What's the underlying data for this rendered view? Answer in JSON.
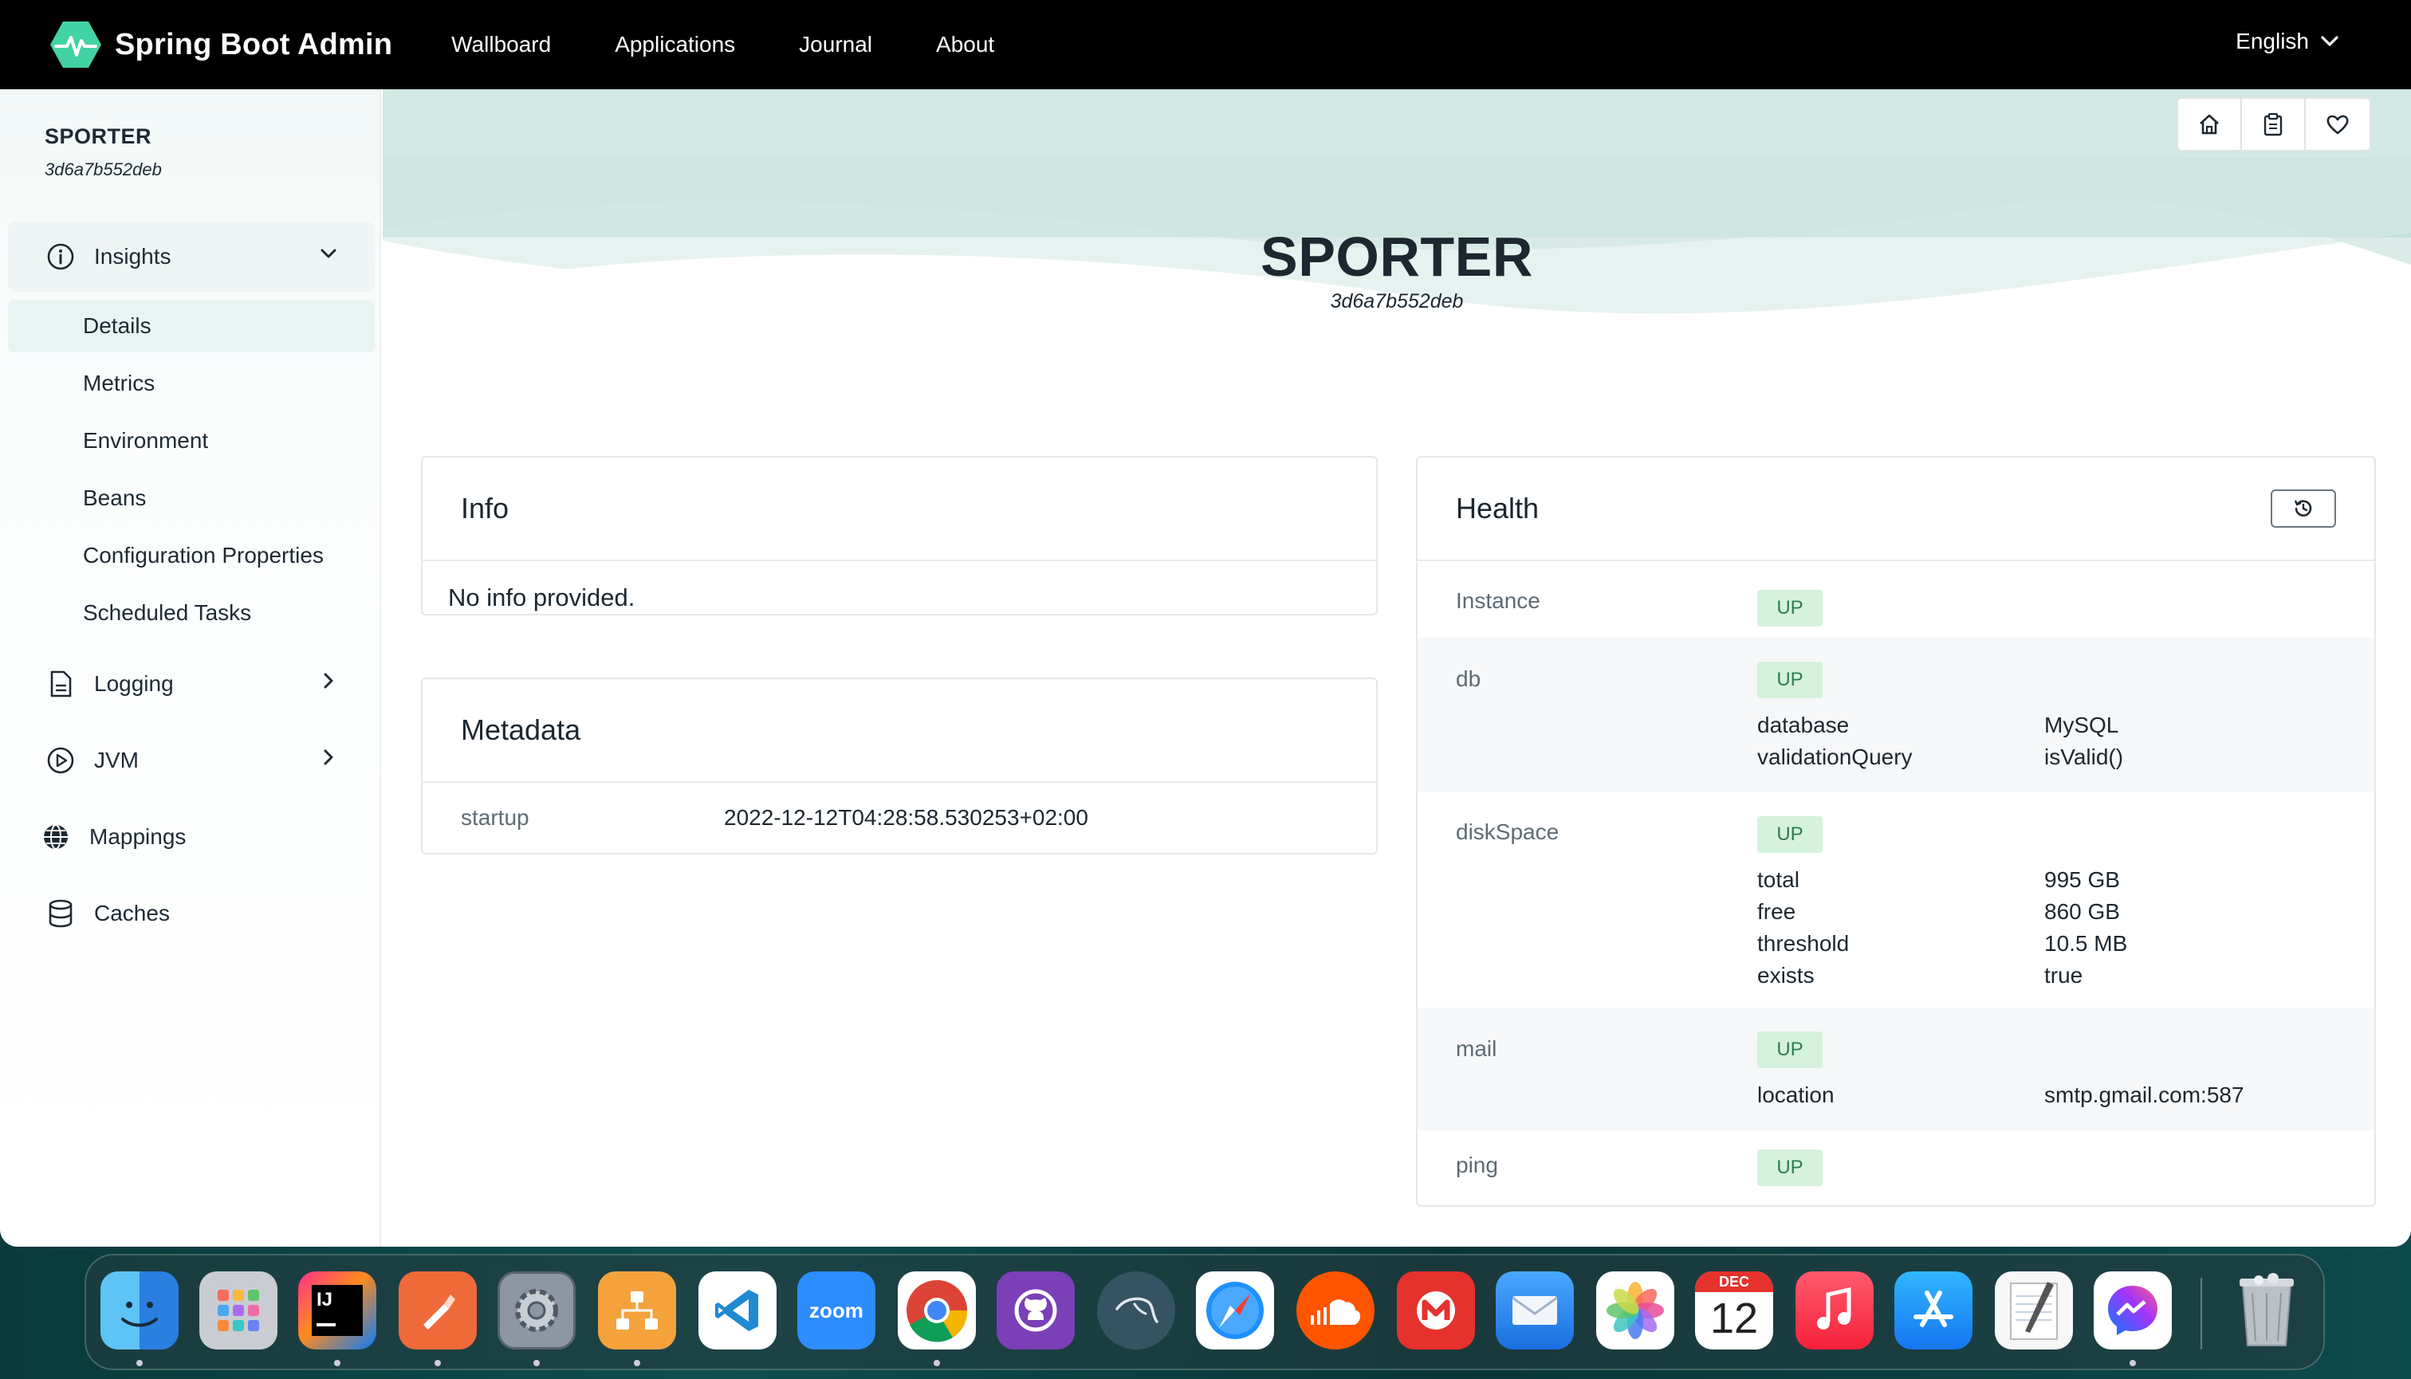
{
  "app": {
    "brand": "Spring Boot Admin",
    "nav": [
      "Wallboard",
      "Applications",
      "Journal",
      "About"
    ],
    "language": "English"
  },
  "sidebar": {
    "app_name": "SPORTER",
    "instance_id": "3d6a7b552deb",
    "groups": {
      "insights": "Insights",
      "logging": "Logging",
      "jvm": "JVM",
      "mappings": "Mappings",
      "caches": "Caches"
    },
    "insights_items": [
      "Details",
      "Metrics",
      "Environment",
      "Beans",
      "Configuration Properties",
      "Scheduled Tasks"
    ],
    "active_item": "Details"
  },
  "header": {
    "title": "SPORTER",
    "subtitle": "3d6a7b552deb"
  },
  "info": {
    "title": "Info",
    "text": "No info provided."
  },
  "metadata": {
    "title": "Metadata",
    "rows": [
      {
        "key": "startup",
        "value": "2022-12-12T04:28:58.530253+02:00"
      }
    ]
  },
  "health": {
    "title": "Health",
    "status_label": "UP",
    "rows": [
      {
        "key": "Instance",
        "status": "UP",
        "details": []
      },
      {
        "key": "db",
        "status": "UP",
        "details": [
          {
            "k": "database",
            "v": "MySQL"
          },
          {
            "k": "validationQuery",
            "v": "isValid()"
          }
        ]
      },
      {
        "key": "diskSpace",
        "status": "UP",
        "details": [
          {
            "k": "total",
            "v": "995 GB"
          },
          {
            "k": "free",
            "v": "860 GB"
          },
          {
            "k": "threshold",
            "v": "10.5 MB"
          },
          {
            "k": "exists",
            "v": "true"
          }
        ]
      },
      {
        "key": "mail",
        "status": "UP",
        "details": [
          {
            "k": "location",
            "v": "smtp.gmail.com:587"
          }
        ]
      },
      {
        "key": "ping",
        "status": "UP",
        "details": []
      }
    ]
  },
  "colors": {
    "navbar": "#000000",
    "accent": "#42d3a5",
    "badge_bg": "#d5f2dc",
    "badge_text": "#2e7d4d"
  },
  "dock": {
    "apps": [
      "Finder",
      "Launchpad",
      "IntelliJ IDEA",
      "Pen app",
      "System Preferences",
      "Diagram app",
      "Visual Studio Code",
      "Zoom",
      "Google Chrome",
      "GitHub Desktop",
      "Kali",
      "Safari",
      "SoundCloud",
      "Mail M",
      "Mail",
      "Photos",
      "Calendar",
      "Music",
      "App Store",
      "TextEdit",
      "Messenger",
      "Trash"
    ],
    "zoom_label": "zoom",
    "intellij_label": "IJ",
    "calendar_month": "DEC",
    "calendar_day": "12"
  }
}
